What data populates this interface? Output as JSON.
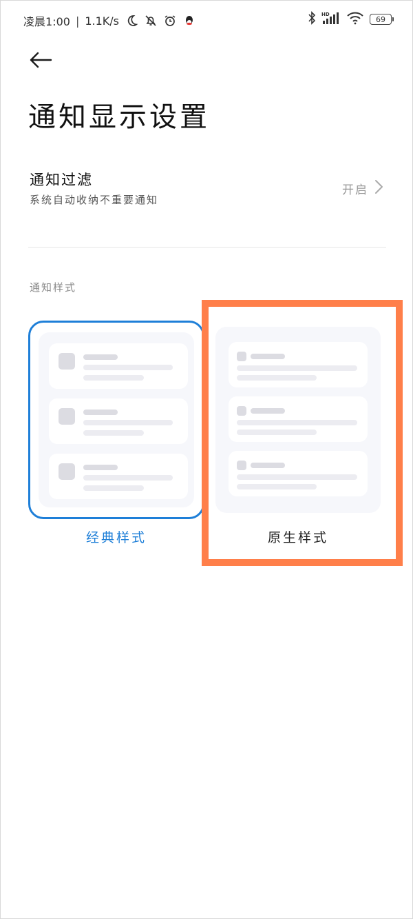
{
  "status_bar": {
    "time": "凌晨1:00",
    "separator": "|",
    "net_speed": "1.1K/s",
    "battery_level": "69",
    "icons_left": [
      "moon-icon",
      "bell-off-icon",
      "alarm-clock-icon",
      "qq-icon"
    ],
    "icons_right": [
      "bluetooth-icon",
      "hd-signal-icon",
      "wifi-icon",
      "battery-icon"
    ]
  },
  "header": {
    "back_icon": "arrow-left-icon",
    "title": "通知显示设置"
  },
  "filter": {
    "title": "通知过滤",
    "subtitle": "系统自动收纳不重要通知",
    "value": "开启"
  },
  "style_section": {
    "label": "通知样式",
    "options": [
      {
        "label": "经典样式",
        "selected": true
      },
      {
        "label": "原生样式",
        "selected": false
      }
    ]
  },
  "colors": {
    "accent": "#1e7fd8",
    "highlight_frame": "#ff7f4a",
    "card_bg": "#f6f7fb"
  }
}
